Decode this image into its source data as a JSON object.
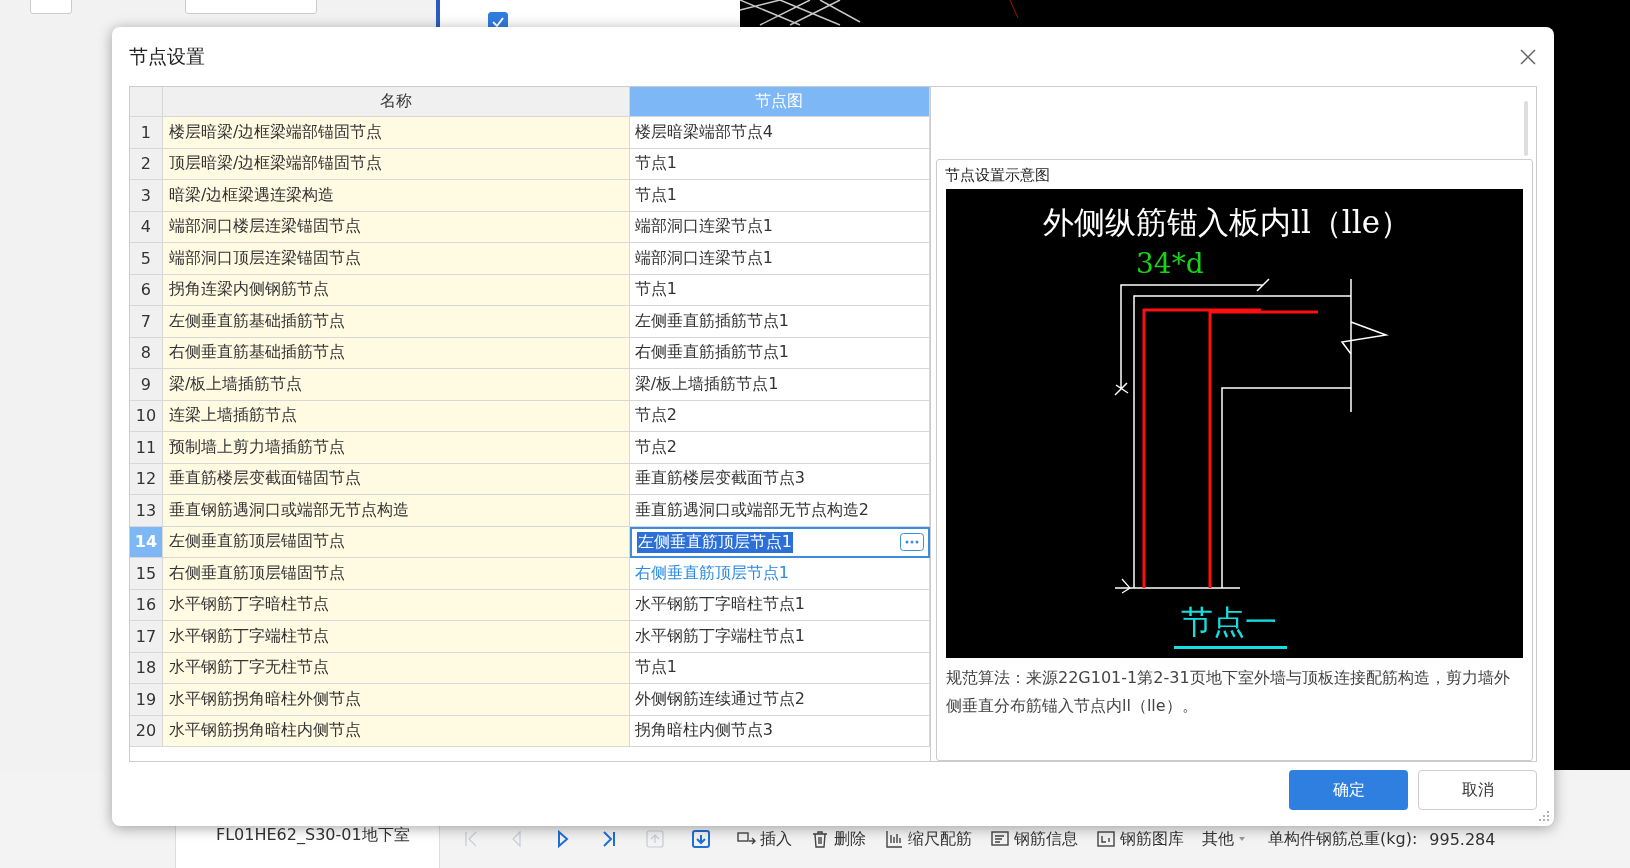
{
  "background": {
    "wall_checkbox": {
      "checked": true
    },
    "tree_item": "FL01HE62_S30-01地下室",
    "toolbar": {
      "nav": [
        {
          "kind": "first",
          "disabled": true
        },
        {
          "kind": "prev",
          "disabled": true
        },
        {
          "kind": "play",
          "disabled": false
        },
        {
          "kind": "last",
          "disabled": false
        },
        {
          "kind": "up",
          "disabled": true
        },
        {
          "kind": "down",
          "disabled": false
        }
      ],
      "actions": [
        {
          "kind": "insert",
          "label": "插入"
        },
        {
          "kind": "delete",
          "label": "删除"
        },
        {
          "kind": "scale",
          "label": "缩尺配筋"
        },
        {
          "kind": "info",
          "label": "钢筋信息"
        },
        {
          "kind": "library",
          "label": "钢筋图库"
        },
        {
          "kind": "dropdown",
          "label": "其他"
        }
      ],
      "total_label": "单构件钢筋总重(kg):",
      "total_value": "995.284"
    }
  },
  "dialog": {
    "title": "节点设置",
    "table": {
      "columns": [
        {
          "label": "名称",
          "selected": false
        },
        {
          "label": "节点图",
          "selected": true
        }
      ],
      "rows": [
        {
          "index": "1",
          "name": "楼层暗梁/边框梁端部锚固节点",
          "node": "楼层暗梁端部节点4",
          "selected": false,
          "modified": false
        },
        {
          "index": "2",
          "name": "顶层暗梁/边框梁端部锚固节点",
          "node": "节点1",
          "selected": false,
          "modified": false
        },
        {
          "index": "3",
          "name": "暗梁/边框梁遇连梁构造",
          "node": "节点1",
          "selected": false,
          "modified": false
        },
        {
          "index": "4",
          "name": "端部洞口楼层连梁锚固节点",
          "node": "端部洞口连梁节点1",
          "selected": false,
          "modified": false
        },
        {
          "index": "5",
          "name": "端部洞口顶层连梁锚固节点",
          "node": "端部洞口连梁节点1",
          "selected": false,
          "modified": false
        },
        {
          "index": "6",
          "name": "拐角连梁内侧钢筋节点",
          "node": "节点1",
          "selected": false,
          "modified": false
        },
        {
          "index": "7",
          "name": "左侧垂直筋基础插筋节点",
          "node": "左侧垂直筋插筋节点1",
          "selected": false,
          "modified": false
        },
        {
          "index": "8",
          "name": "右侧垂直筋基础插筋节点",
          "node": "右侧垂直筋插筋节点1",
          "selected": false,
          "modified": false
        },
        {
          "index": "9",
          "name": "梁/板上墙插筋节点",
          "node": "梁/板上墙插筋节点1",
          "selected": false,
          "modified": false
        },
        {
          "index": "10",
          "name": "连梁上墙插筋节点",
          "node": "节点2",
          "selected": false,
          "modified": false
        },
        {
          "index": "11",
          "name": "预制墙上剪力墙插筋节点",
          "node": "节点2",
          "selected": false,
          "modified": false
        },
        {
          "index": "12",
          "name": "垂直筋楼层变截面锚固节点",
          "node": "垂直筋楼层变截面节点3",
          "selected": false,
          "modified": false
        },
        {
          "index": "13",
          "name": "垂直钢筋遇洞口或端部无节点构造",
          "node": "垂直筋遇洞口或端部无节点构造2",
          "selected": false,
          "modified": false
        },
        {
          "index": "14",
          "name": "左侧垂直筋顶层锚固节点",
          "node": "左侧垂直筋顶层节点1",
          "selected": true,
          "modified": false
        },
        {
          "index": "15",
          "name": "右侧垂直筋顶层锚固节点",
          "node": "右侧垂直筋顶层节点1",
          "selected": false,
          "modified": true
        },
        {
          "index": "16",
          "name": "水平钢筋丁字暗柱节点",
          "node": "水平钢筋丁字暗柱节点1",
          "selected": false,
          "modified": false
        },
        {
          "index": "17",
          "name": "水平钢筋丁字端柱节点",
          "node": "水平钢筋丁字端柱节点1",
          "selected": false,
          "modified": false
        },
        {
          "index": "18",
          "name": "水平钢筋丁字无柱节点",
          "node": "节点1",
          "selected": false,
          "modified": false
        },
        {
          "index": "19",
          "name": "水平钢筋拐角暗柱外侧节点",
          "node": "外侧钢筋连续通过节点2",
          "selected": false,
          "modified": false
        },
        {
          "index": "20",
          "name": "水平钢筋拐角暗柱内侧节点",
          "node": "拐角暗柱内侧节点3",
          "selected": false,
          "modified": false
        }
      ]
    },
    "preview": {
      "title": "节点设置示意图",
      "diagram_title": "外侧纵筋锚入板内ll（lle）",
      "dimension": "34*d",
      "caption": "节点一",
      "description": "规范算法：来源22G101-1第2-31页地下室外墙与顶板连接配筋构造，剪力墙外侧垂直分布筋锚入节点内ll（lle）。"
    },
    "buttons": [
      {
        "label": "确定",
        "kind": "primary"
      },
      {
        "label": "取消",
        "kind": "default"
      }
    ]
  }
}
